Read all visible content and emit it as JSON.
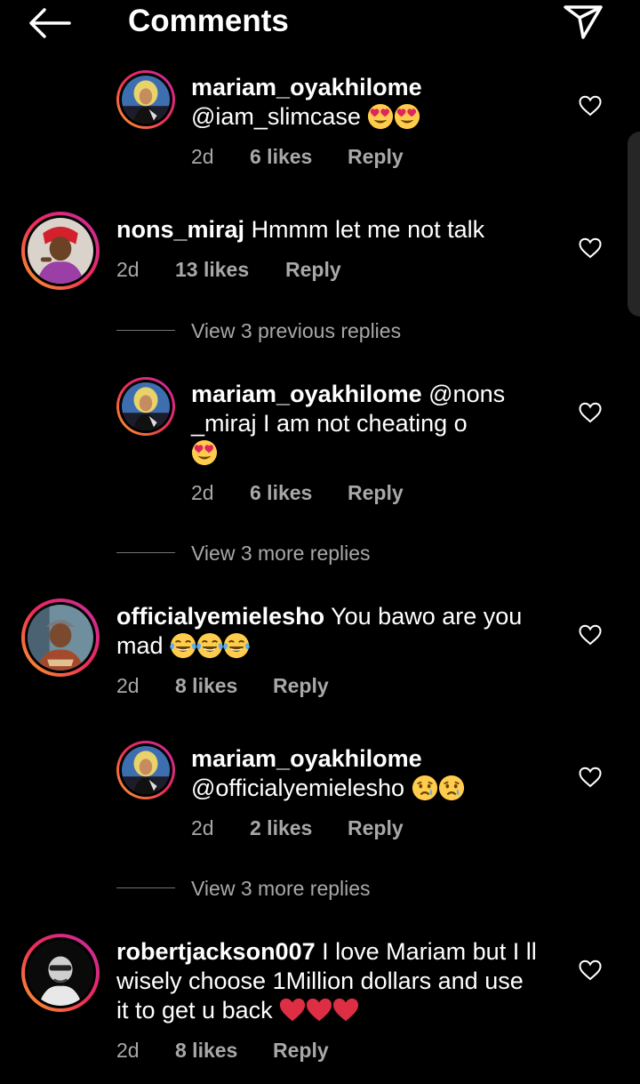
{
  "header": {
    "title": "Comments",
    "back_icon": "arrow-left-icon",
    "send_icon": "send-paper-plane-icon"
  },
  "comments": [
    {
      "username": "mariam_oyakhilome",
      "text_lines": [
        "@iam_slimcase"
      ],
      "emoji": [
        "heart-eyes",
        "heart-eyes"
      ],
      "time": "2d",
      "likes": "6 likes",
      "reply": "Reply"
    },
    {
      "username": "nons_miraj",
      "text": "Hmmm let me not talk",
      "time": "2d",
      "likes": "13 likes",
      "reply": "Reply"
    },
    {
      "view_previous": "View 3 previous replies"
    },
    {
      "username": "mariam_oyakhilome",
      "text_lines": [
        "@nons",
        "_miraj I am not cheating o"
      ],
      "emoji": [
        "heart-eyes"
      ],
      "time": "2d",
      "likes": "6 likes",
      "reply": "Reply"
    },
    {
      "view_more": "View 3 more replies"
    },
    {
      "username": "officialyemielesho",
      "text_lines": [
        "You bawo are you",
        "mad"
      ],
      "emoji": [
        "tears-of-joy",
        "tears-of-joy",
        "tears-of-joy"
      ],
      "time": "2d",
      "likes": "8 likes",
      "reply": "Reply"
    },
    {
      "username": "mariam_oyakhilome",
      "text_lines": [
        "@officialyemielesho"
      ],
      "emoji": [
        "crying",
        "crying"
      ],
      "time": "2d",
      "likes": "2 likes",
      "reply": "Reply"
    },
    {
      "view_more": "View 3 more replies"
    },
    {
      "username": "robertjackson007",
      "text_lines": [
        "I love Mariam but I ll",
        "wisely choose 1Million dollars and use",
        "it to get u back"
      ],
      "emoji": [
        "red-heart",
        "red-heart",
        "red-heart"
      ],
      "time": "2d",
      "likes": "8 likes",
      "reply": "Reply"
    }
  ],
  "colors": {
    "background": "#000000",
    "text": "#ffffff",
    "meta_text": "#a8a8a8",
    "story_ring_start": "#f9a225",
    "story_ring_end": "#c32aa3"
  }
}
